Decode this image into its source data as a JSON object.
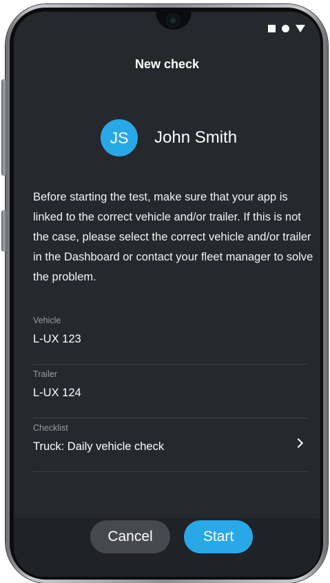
{
  "header": {
    "title": "New check"
  },
  "status_bar": {
    "icons": [
      "square-icon",
      "circle-icon",
      "triangle-icon"
    ]
  },
  "user": {
    "initials": "JS",
    "name": "John Smith",
    "avatar_color": "#29a8e8"
  },
  "intro_text": "Before starting the test, make sure that your app is linked to the correct vehicle and/or trailer. If this is not the case, please select the correct vehicle and/or trailer in the Dashboard or contact your fleet manager to solve the problem.",
  "fields": [
    {
      "label": "Vehicle",
      "value": "L-UX 123"
    },
    {
      "label": "Trailer",
      "value": "L-UX 124"
    },
    {
      "label": "Checklist",
      "value": "Truck: Daily vehicle check"
    }
  ],
  "actions": {
    "cancel_label": "Cancel",
    "start_label": "Start"
  },
  "colors": {
    "accent": "#29a8e8",
    "background": "#25282c",
    "secondary_button": "#454a50"
  }
}
